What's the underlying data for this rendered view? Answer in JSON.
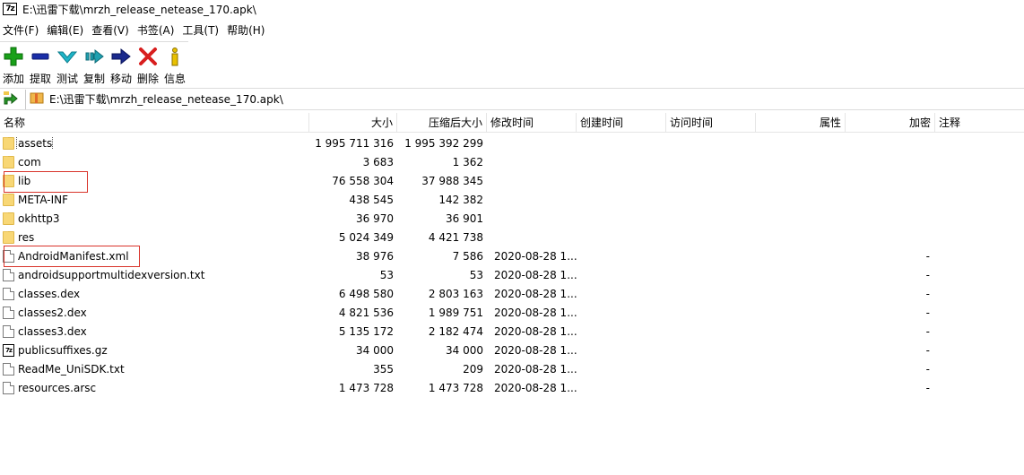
{
  "window": {
    "app_icon_label": "7z",
    "title": "E:\\迅雷下载\\mrzh_release_netease_170.apk\\"
  },
  "menu": [
    "文件(F)",
    "编辑(E)",
    "查看(V)",
    "书签(A)",
    "工具(T)",
    "帮助(H)"
  ],
  "toolbar": [
    {
      "label": "添加",
      "icon": "add-icon",
      "color": "#19a019"
    },
    {
      "label": "提取",
      "icon": "extract-icon",
      "color": "#1a2ea8"
    },
    {
      "label": "测试",
      "icon": "test-icon",
      "color": "#1fb5c8"
    },
    {
      "label": "复制",
      "icon": "copy-icon",
      "color": "#1fa0b0"
    },
    {
      "label": "移动",
      "icon": "move-icon",
      "color": "#1a2a8c"
    },
    {
      "label": "删除",
      "icon": "delete-icon",
      "color": "#d81e1e"
    },
    {
      "label": "信息",
      "icon": "info-icon",
      "color": "#e8c000"
    }
  ],
  "address": {
    "path": "E:\\迅雷下载\\mrzh_release_netease_170.apk\\"
  },
  "columns": {
    "name": "名称",
    "size": "大小",
    "packed": "压缩后大小",
    "modified": "修改时间",
    "created": "创建时间",
    "accessed": "访问时间",
    "attributes": "属性",
    "encrypted": "加密",
    "comment": "注释"
  },
  "files": [
    {
      "name": "assets",
      "type": "folder",
      "size": "1 995 711 316",
      "packed": "1 995 392 299",
      "modified": "",
      "encrypted": ""
    },
    {
      "name": "com",
      "type": "folder",
      "size": "3 683",
      "packed": "1 362",
      "modified": "",
      "encrypted": ""
    },
    {
      "name": "lib",
      "type": "folder",
      "size": "76 558 304",
      "packed": "37 988 345",
      "modified": "",
      "encrypted": ""
    },
    {
      "name": "META-INF",
      "type": "folder",
      "size": "438 545",
      "packed": "142 382",
      "modified": "",
      "encrypted": ""
    },
    {
      "name": "okhttp3",
      "type": "folder",
      "size": "36 970",
      "packed": "36 901",
      "modified": "",
      "encrypted": ""
    },
    {
      "name": "res",
      "type": "folder",
      "size": "5 024 349",
      "packed": "4 421 738",
      "modified": "",
      "encrypted": ""
    },
    {
      "name": "AndroidManifest.xml",
      "type": "file",
      "size": "38 976",
      "packed": "7 586",
      "modified": "2020-08-28 1...",
      "encrypted": "-"
    },
    {
      "name": "androidsupportmultidexversion.txt",
      "type": "file",
      "size": "53",
      "packed": "53",
      "modified": "2020-08-28 1...",
      "encrypted": "-"
    },
    {
      "name": "classes.dex",
      "type": "file",
      "size": "6 498 580",
      "packed": "2 803 163",
      "modified": "2020-08-28 1...",
      "encrypted": "-"
    },
    {
      "name": "classes2.dex",
      "type": "file",
      "size": "4 821 536",
      "packed": "1 989 751",
      "modified": "2020-08-28 1...",
      "encrypted": "-"
    },
    {
      "name": "classes3.dex",
      "type": "file",
      "size": "5 135 172",
      "packed": "2 182 474",
      "modified": "2020-08-28 1...",
      "encrypted": "-"
    },
    {
      "name": "publicsuffixes.gz",
      "type": "archive",
      "size": "34 000",
      "packed": "34 000",
      "modified": "2020-08-28 1...",
      "encrypted": "-"
    },
    {
      "name": "ReadMe_UniSDK.txt",
      "type": "file",
      "size": "355",
      "packed": "209",
      "modified": "2020-08-28 1...",
      "encrypted": "-"
    },
    {
      "name": "resources.arsc",
      "type": "file",
      "size": "1 473 728",
      "packed": "1 473 728",
      "modified": "2020-08-28 1...",
      "encrypted": "-"
    }
  ],
  "highlight_color": "#d9342b"
}
